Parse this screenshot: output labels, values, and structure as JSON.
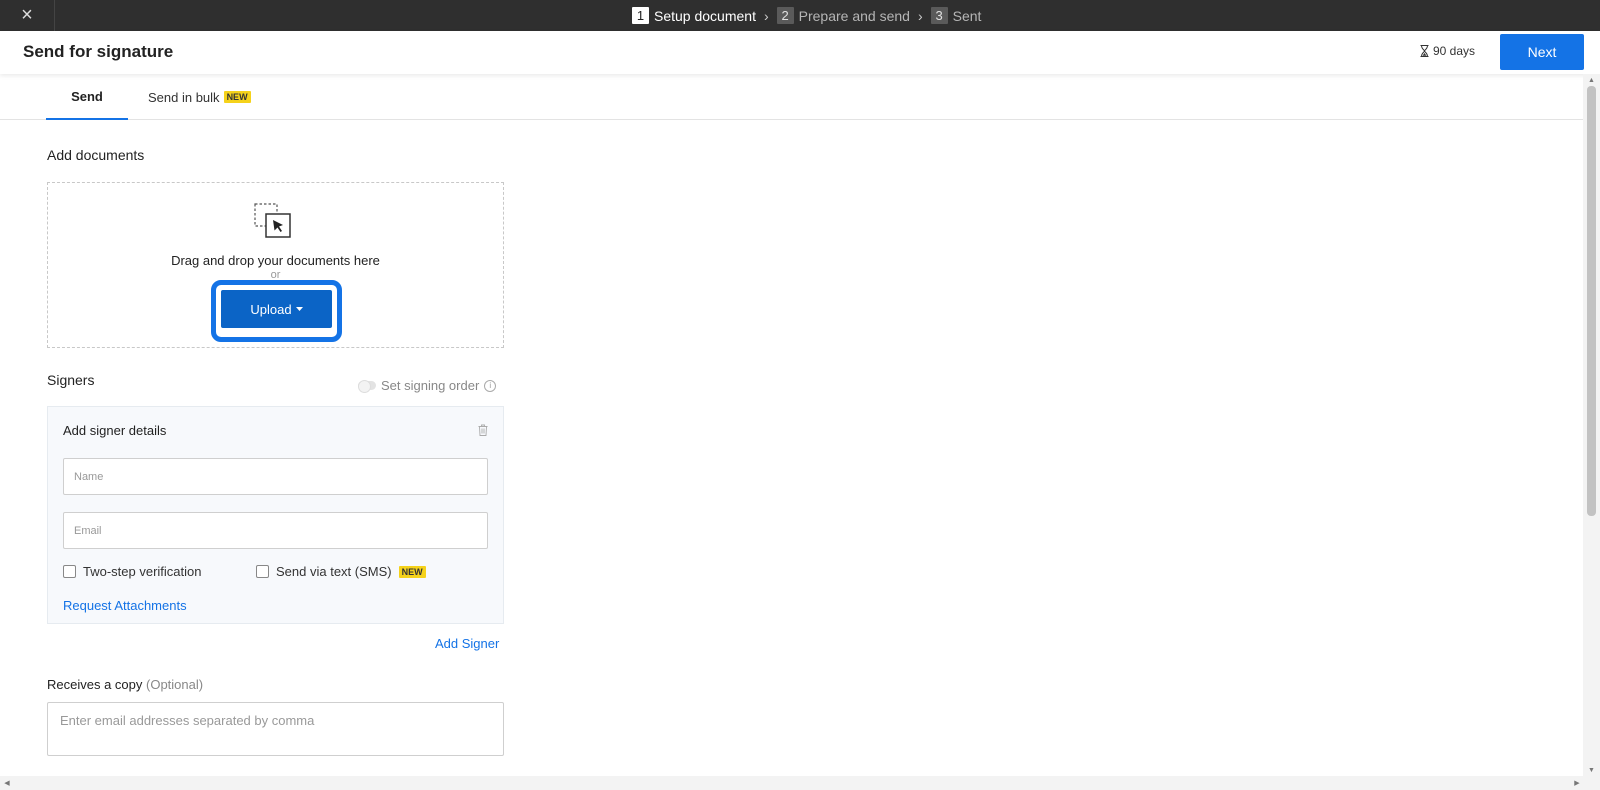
{
  "topbar": {
    "close_icon": "×",
    "steps": [
      {
        "num": "1",
        "label": "Setup document"
      },
      {
        "num": "2",
        "label": "Prepare and send"
      },
      {
        "num": "3",
        "label": "Sent"
      }
    ],
    "separator": "›"
  },
  "header": {
    "title": "Send for signature",
    "expiry": "90 days",
    "next_label": "Next"
  },
  "tabs": {
    "send": "Send",
    "bulk": "Send in bulk",
    "bulk_badge": "NEW"
  },
  "documents": {
    "heading": "Add documents",
    "drop_text": "Drag and drop your documents here",
    "or_text": "or",
    "upload_label": "Upload"
  },
  "signers": {
    "heading": "Signers",
    "signing_order": "Set signing order",
    "card_title": "Add signer details",
    "name_placeholder": "Name",
    "email_placeholder": "Email",
    "two_step": "Two-step verification",
    "sms": "Send via text (SMS)",
    "sms_badge": "NEW",
    "request_attachments": "Request Attachments",
    "add_signer": "Add Signer"
  },
  "copy": {
    "label": "Receives a copy",
    "optional": "(Optional)",
    "placeholder": "Enter email addresses separated by comma"
  },
  "colors": {
    "accent": "#1473e6",
    "topbar": "#2f2f2f",
    "badge": "#f5d21b"
  }
}
